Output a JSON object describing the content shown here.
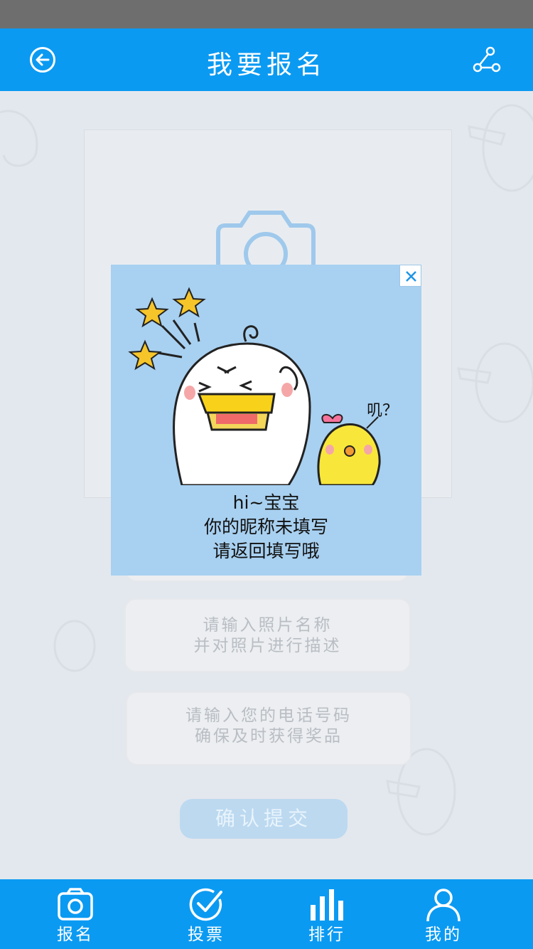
{
  "header": {
    "title": "我要报名",
    "back_icon": "back-circle-icon",
    "share_icon": "share-icon"
  },
  "form": {
    "photo_placeholder_icon": "camera-icon",
    "photo_name_lines": [
      "请输入照片名称",
      "并对照片进行描述"
    ],
    "phone_lines": [
      "请输入您的电话号码",
      "确保及时获得奖品"
    ],
    "submit_label": "确认提交"
  },
  "popup": {
    "close_icon": "close-icon",
    "bubble_text": "叽？",
    "message_lines": [
      "hi~宝宝",
      "你的昵称未填写",
      "请返回填写哦"
    ]
  },
  "tabbar": {
    "items": [
      {
        "label": "报名",
        "icon": "camera-icon"
      },
      {
        "label": "投票",
        "icon": "check-circle-icon"
      },
      {
        "label": "排行",
        "icon": "bar-chart-icon"
      },
      {
        "label": "我的",
        "icon": "user-icon"
      }
    ]
  },
  "colors": {
    "primary": "#0b9af2",
    "background": "#e3e8ee",
    "popup_bg": "#a8d0f0",
    "submit_bg": "#bcd9f0"
  }
}
